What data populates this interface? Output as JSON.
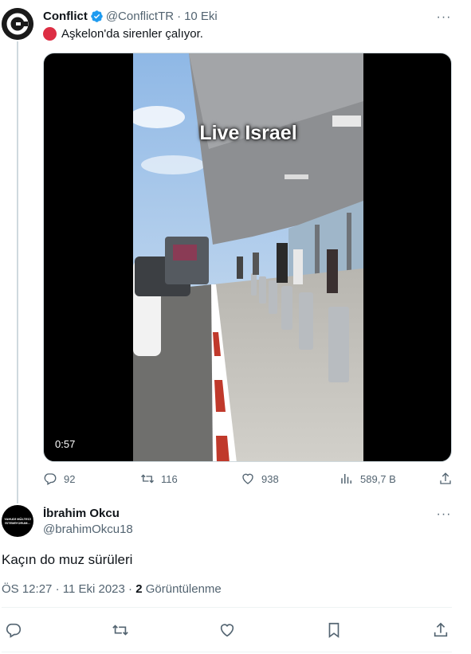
{
  "tweet": {
    "author_name": "Conflict",
    "author_handle": "@ConflictTR",
    "separator": "·",
    "date": "10 Eki",
    "text": "Aşkelon'da sirenler çalıyor.",
    "more_label": "···",
    "media": {
      "overlay_text": "Live Israel",
      "duration": "0:57"
    },
    "stats": {
      "replies": "92",
      "retweets": "116",
      "likes": "938",
      "views": "589,7 B"
    }
  },
  "reply": {
    "author_name": "İbrahim Okcu",
    "author_handle": "@brahimOkcu18",
    "more_label": "···",
    "avatar_text": "YAHUDİ MÜLTECİ İSTEMİYORUM...",
    "text": "Kaçın do muz sürüleri",
    "time": "ÖS 12:27",
    "separator1": "·",
    "date": "11 Eki 2023",
    "separator2": "·",
    "views_count": "2",
    "views_label": "Görüntülenme"
  },
  "colors": {
    "text_primary": "#0f1419",
    "text_secondary": "#536471",
    "verified_blue": "#1d9bf0",
    "red_circle": "#dd2e44",
    "divider": "#eff3f4"
  },
  "icons": [
    "verified-icon",
    "red-circle-icon",
    "reply-icon",
    "retweet-icon",
    "like-icon",
    "views-icon",
    "share-icon",
    "bookmark-icon",
    "more-icon"
  ]
}
